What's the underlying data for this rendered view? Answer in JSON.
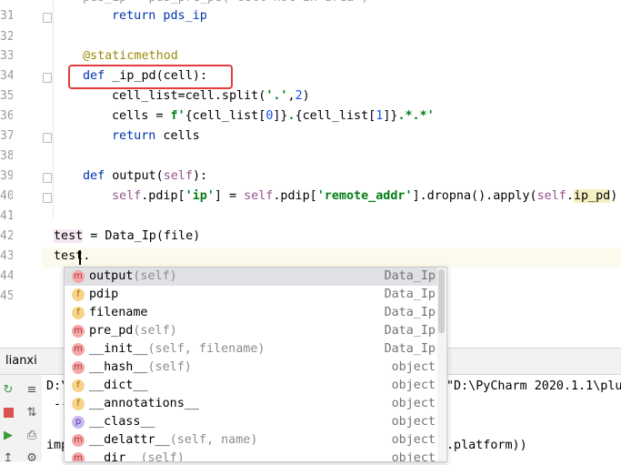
{
  "editor": {
    "line_numbers": [
      "31",
      "32",
      "33",
      "34",
      "35",
      "36",
      "37",
      "38",
      "39",
      "40",
      "41",
      "42",
      "43",
      "44",
      "45"
    ],
    "top_partial": "pds_ip = pds_pre_pd( cell not in area )",
    "lines": {
      "l31": "return pds_ip",
      "l33": "@staticmethod",
      "l34_kw": "def",
      "l34_rest": " _ip_pd(cell):",
      "l35_a": "cell_list=cell.split(",
      "l35_str": "'.'",
      "l35_b": ",",
      "l35_num": "2",
      "l35_c": ")",
      "l36_a": "cells = ",
      "l36_str1": "f'",
      "l36_b": "{cell_list[",
      "l36_num1": "0",
      "l36_c": "]}",
      "l36_str2": ".",
      "l36_d": "{cell_list[",
      "l36_num2": "1",
      "l36_e": "]}",
      "l36_str3": ".*.*'",
      "l37_kw": "return",
      "l37_rest": " cells",
      "l39_kw": "def",
      "l39_a": " output(",
      "l39_self": "self",
      "l39_b": "):",
      "l40_self1": "self",
      "l40_a": ".pdip[",
      "l40_str1": "'ip'",
      "l40_b": "] = ",
      "l40_self2": "self",
      "l40_c": ".pdip[",
      "l40_str2": "'remote_addr'",
      "l40_d": "].dropna().apply(",
      "l40_self3": "self",
      "l40_e": ".",
      "l40_hl": "ip_pd",
      "l40_f": ")",
      "l42_hl": "test",
      "l42_rest": " = Data_Ip(file)",
      "l43": "test."
    }
  },
  "run_panel": {
    "tab_label": "lianxi",
    "console_line1_left": "D:\\",
    "console_line1_right": "\"D:\\PyCharm 2020.1.1\\plu",
    "console_line2": " --",
    "console_line4_left": "imp",
    "console_line4_right": ".platform))"
  },
  "completion": {
    "items": [
      {
        "kind": "m",
        "name": "output",
        "params": "(self)",
        "type": "Data_Ip"
      },
      {
        "kind": "f",
        "name": "pdip",
        "params": "",
        "type": "Data_Ip"
      },
      {
        "kind": "f",
        "name": "filename",
        "params": "",
        "type": "Data_Ip"
      },
      {
        "kind": "m",
        "name": "pre_pd",
        "params": "(self)",
        "type": "Data_Ip"
      },
      {
        "kind": "m",
        "name": "__init__",
        "params": "(self, filename)",
        "type": "Data_Ip"
      },
      {
        "kind": "m",
        "name": "__hash__",
        "params": "(self)",
        "type": "object"
      },
      {
        "kind": "f",
        "name": "__dict__",
        "params": "",
        "type": "object"
      },
      {
        "kind": "f",
        "name": "__annotations__",
        "params": "",
        "type": "object"
      },
      {
        "kind": "p",
        "name": "__class__",
        "params": "",
        "type": "object"
      },
      {
        "kind": "m",
        "name": "__delattr__",
        "params": "(self, name)",
        "type": "object"
      },
      {
        "kind": "m",
        "name": "__dir__",
        "params": "(self)",
        "type": "object"
      }
    ]
  },
  "colors": {
    "keyword": "#0033b3",
    "self": "#94558d",
    "string": "#067d17",
    "number": "#1750eb",
    "decorator": "#9e880d",
    "highlight_box": "#e33c3c"
  }
}
